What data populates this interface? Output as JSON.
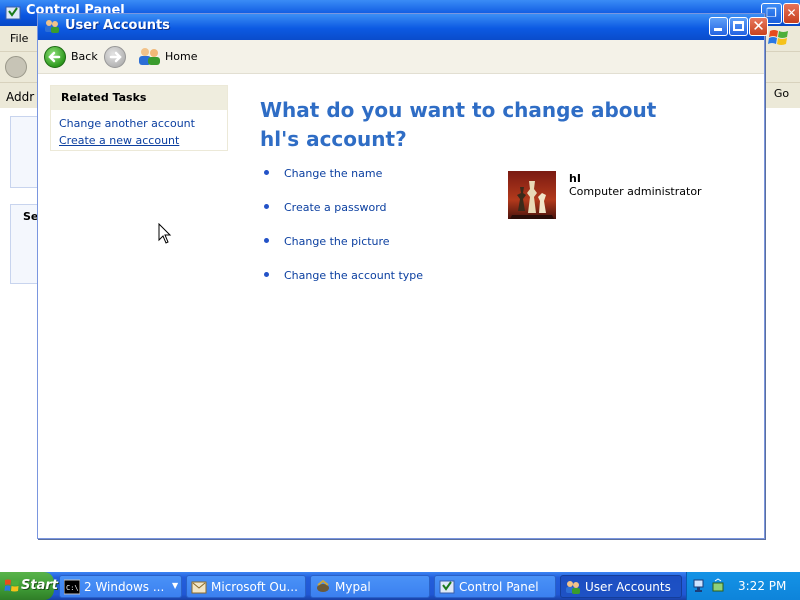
{
  "background_window": {
    "title": "Control Panel",
    "menu_file": "File",
    "address_label": "Addr",
    "go_label": "Go",
    "partial_section_label": "Se"
  },
  "user_accounts_window": {
    "title": "User Accounts",
    "nav": {
      "back_label": "Back",
      "home_label": "Home"
    },
    "related_tasks": {
      "title": "Related Tasks",
      "links": [
        "Change another account",
        "Create a new account"
      ]
    },
    "question": "What do you want to change about hl's account?",
    "options": [
      "Change the name",
      "Create a password",
      "Change the picture",
      "Change the account type"
    ],
    "account": {
      "name": "hI",
      "role": "Computer administrator",
      "picture": "chess-pieces-picture"
    }
  },
  "taskbar": {
    "start_label": "Start",
    "buttons": [
      {
        "label": "2 Windows ...",
        "icon": "command-prompt-icon"
      },
      {
        "label": "Microsoft Ou...",
        "icon": "outlook-icon"
      },
      {
        "label": "Mypal",
        "icon": "mypal-icon"
      },
      {
        "label": "Control Panel",
        "icon": "control-panel-icon"
      },
      {
        "label": "User Accounts",
        "icon": "user-accounts-icon",
        "active": true
      }
    ],
    "clock": "3:22 PM"
  },
  "colors": {
    "title_blue": "#0a55e0",
    "heading_blue": "#2f6dc5",
    "link_blue": "#0b3fa0",
    "taskbar_blue": "#245edb",
    "start_green": "#3e9a35"
  }
}
